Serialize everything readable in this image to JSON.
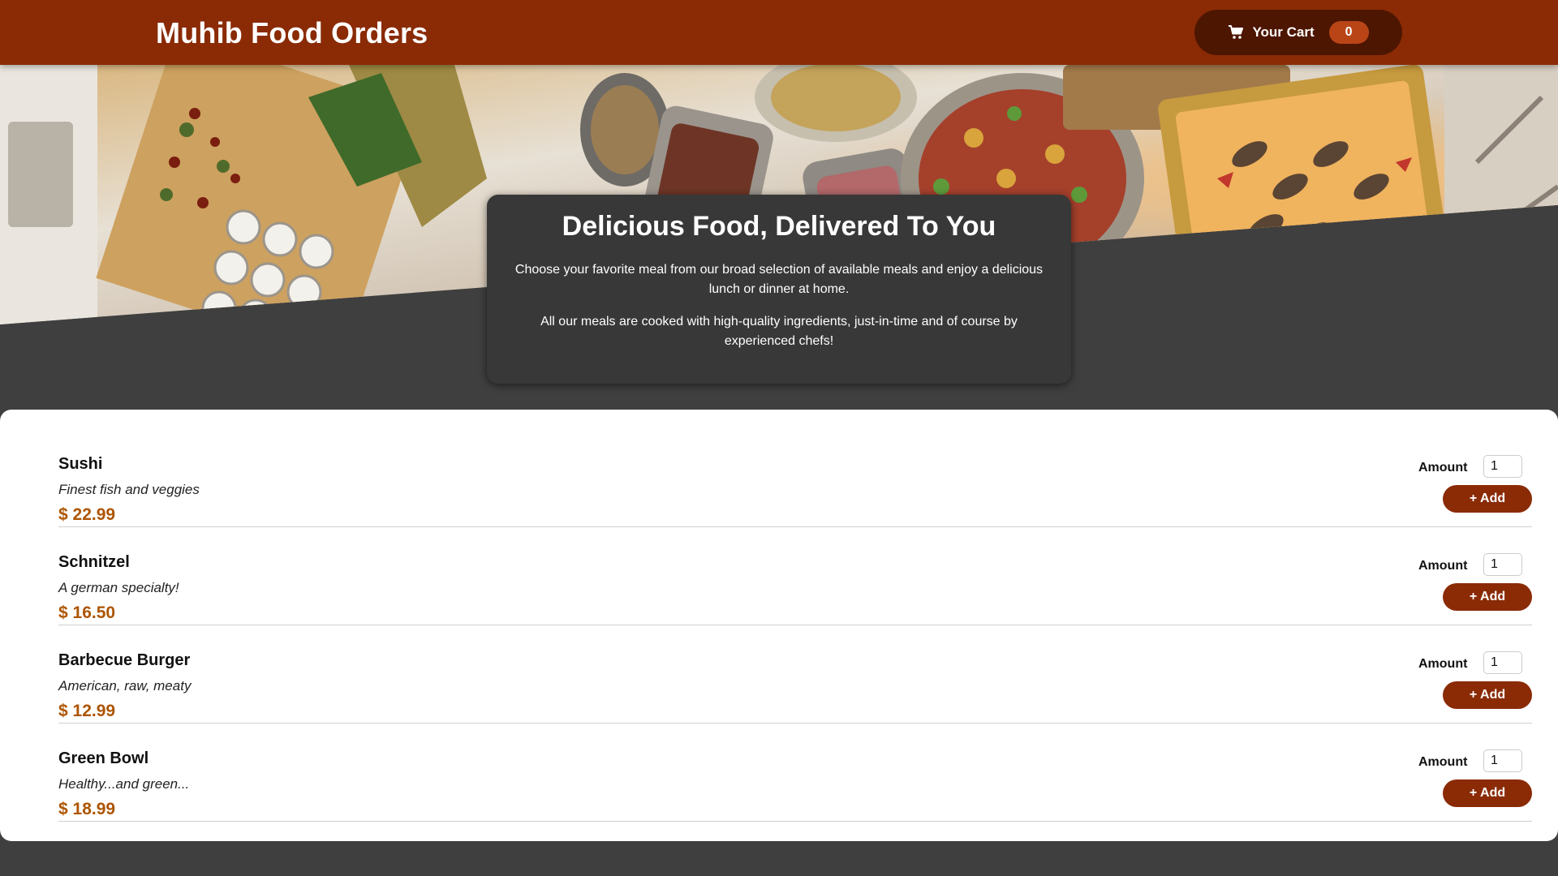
{
  "header": {
    "title": "Muhib Food Orders",
    "cart_label": "Your Cart",
    "cart_count": "0"
  },
  "colors": {
    "header_bg": "#8a2b06",
    "cart_button_bg": "#4d1601",
    "badge_bg": "#b94517",
    "price": "#ad5502",
    "page_bg": "#3f3f3f"
  },
  "summary": {
    "title": "Delicious Food, Delivered To You",
    "paragraph1": "Choose your favorite meal from our broad selection of available meals and enjoy a delicious lunch or dinner at home.",
    "paragraph2": "All our meals are cooked with high-quality ingredients, just-in-time and of course by experienced chefs!"
  },
  "meals": [
    {
      "name": "Sushi",
      "description": "Finest fish and veggies",
      "price": "$ 22.99",
      "amount_label": "Amount",
      "amount_value": "1",
      "add_label": "+ Add"
    },
    {
      "name": "Schnitzel",
      "description": "A german specialty!",
      "price": "$ 16.50",
      "amount_label": "Amount",
      "amount_value": "1",
      "add_label": "+ Add"
    },
    {
      "name": "Barbecue Burger",
      "description": "American, raw, meaty",
      "price": "$ 12.99",
      "amount_label": "Amount",
      "amount_value": "1",
      "add_label": "+ Add"
    },
    {
      "name": "Green Bowl",
      "description": "Healthy...and green...",
      "price": "$ 18.99",
      "amount_label": "Amount",
      "amount_value": "1",
      "add_label": "+ Add"
    }
  ]
}
